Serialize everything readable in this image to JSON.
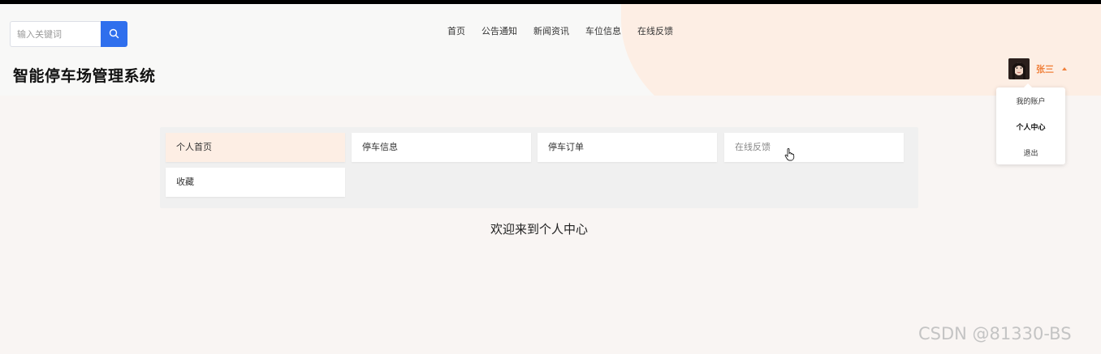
{
  "search": {
    "placeholder": "输入关键词",
    "button_icon": "search-icon"
  },
  "nav": {
    "items": [
      "首页",
      "公告通知",
      "新闻资讯",
      "车位信息",
      "在线反馈"
    ]
  },
  "site": {
    "title": "智能停车场管理系统"
  },
  "user": {
    "name": "张三",
    "dropdown": [
      "我的账户",
      "个人中心",
      "退出"
    ],
    "active_dropdown": "个人中心"
  },
  "center_menu": {
    "items": [
      "个人首页",
      "停车信息",
      "停车订单",
      "在线反馈",
      "收藏"
    ],
    "active": "个人首页"
  },
  "welcome": "欢迎来到个人中心",
  "watermark": "CSDN @81330-BS",
  "colors": {
    "accent_button": "#2f6fed",
    "highlight": "#f0813c",
    "active_bg": "#fdeee4"
  }
}
